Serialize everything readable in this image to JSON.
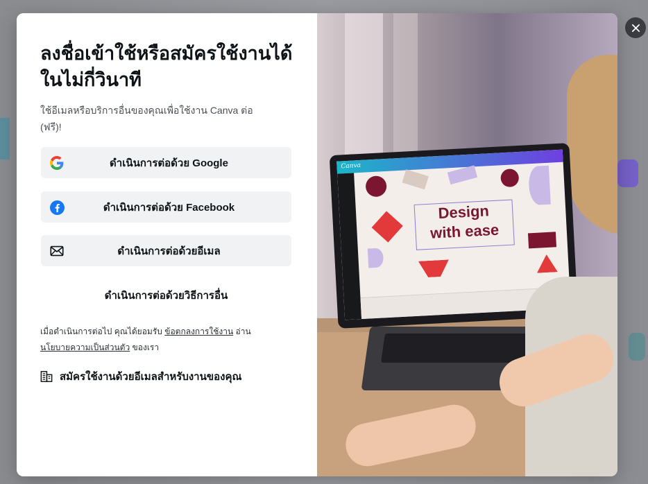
{
  "modal": {
    "title": "ลงชื่อเข้าใช้หรือสมัครใช้งานได้ในไม่กี่วินาที",
    "subtitle": "ใช้อีเมลหรือบริการอื่นของคุณเพื่อใช้งาน Canva ต่อ (ฟรี)!",
    "buttons": {
      "google": {
        "label": "ดำเนินการต่อด้วย Google",
        "icon": "google-icon"
      },
      "facebook": {
        "label": "ดำเนินการต่อด้วย Facebook",
        "icon": "facebook-icon"
      },
      "email": {
        "label": "ดำเนินการต่อด้วยอีเมล",
        "icon": "envelope-icon"
      },
      "other": {
        "label": "ดำเนินการต่อด้วยวิธีการอื่น"
      }
    },
    "legal": {
      "prefix": "เมื่อดำเนินการต่อไป คุณได้ยอมรับ",
      "terms_link": "ข้อตกลงการใช้งาน",
      "middle": "อ่าน",
      "privacy_link": "นโยบายความเป็นส่วนตัว",
      "suffix": "ของเรา"
    },
    "work_signup": {
      "label": "สมัครใช้งานด้วยอีเมลสำหรับงานของคุณ",
      "icon": "office-building-icon"
    },
    "close_icon": "close-icon"
  },
  "hero": {
    "app_logo": "Canva",
    "design_text_line1": "Design",
    "design_text_line2": "with ease"
  },
  "colors": {
    "google_blue": "#4285F4",
    "google_red": "#EA4335",
    "google_yellow": "#FBBC05",
    "google_green": "#34A853",
    "facebook_blue": "#1877F2",
    "button_bg": "#f1f2f4",
    "text": "#0e1318"
  }
}
